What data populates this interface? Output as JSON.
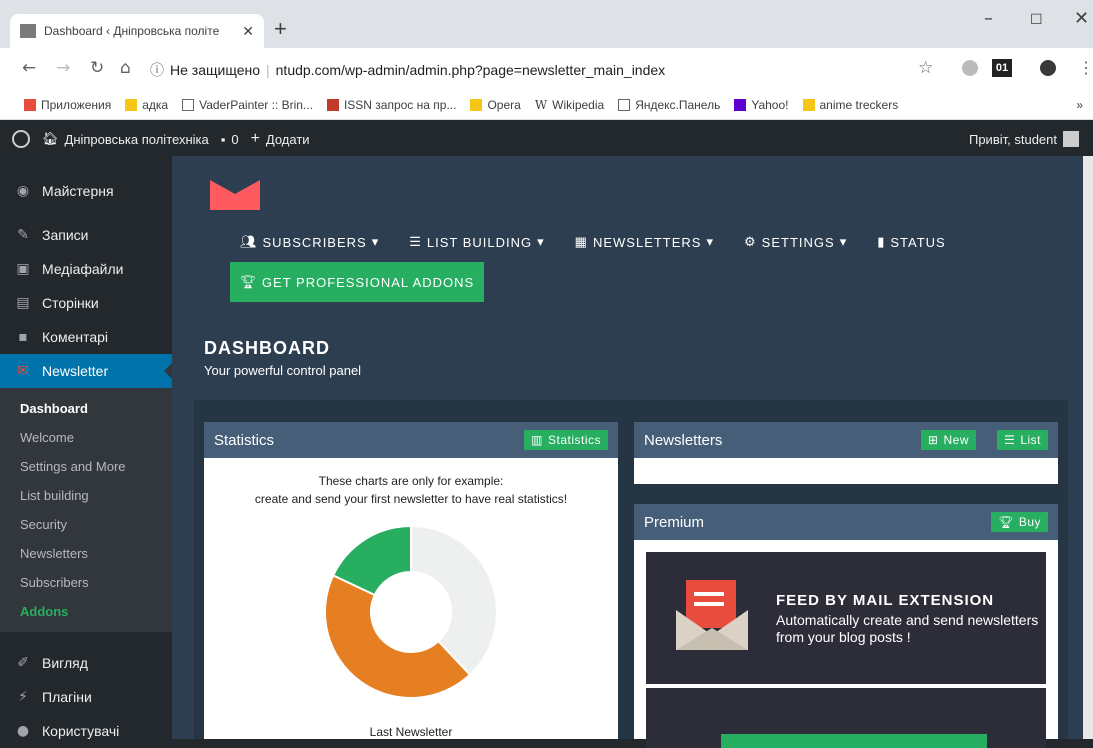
{
  "browser": {
    "tab_title": "Dashboard ‹ Дніпровська політе",
    "address_security": "Не защищено",
    "address_url": "ntudp.com/wp-admin/admin.php?page=newsletter_main_index",
    "bookmarks": [
      "Приложения",
      "адка",
      "VaderPainter :: Brin...",
      "ISSN запрос на пр...",
      "Opera",
      "Wikipedia",
      "Яндекс.Панель",
      "Yahoo!",
      "anime treckers"
    ],
    "ext_label": "01",
    "more_bookmarks": "»"
  },
  "adminbar": {
    "site_name": "Дніпровська політехніка",
    "comments_count": "0",
    "add_label": "Додати",
    "greeting": "Привіт, student"
  },
  "sidebar": {
    "items_top": [
      "Майстерня",
      "Записи",
      "Медіафайли",
      "Сторінки",
      "Коментарі"
    ],
    "newsletter_label": "Newsletter",
    "submenu": [
      "Dashboard",
      "Welcome",
      "Settings and More",
      "List building",
      "Security",
      "Newsletters",
      "Subscribers",
      "Addons"
    ],
    "items_bottom": [
      "Вигляд",
      "Плагіни",
      "Користувачі"
    ]
  },
  "plugin_nav": {
    "subscribers": "SUBSCRIBERS",
    "list_building": "LIST BUILDING",
    "newsletters": "NEWSLETTERS",
    "settings": "SETTINGS",
    "status": "STATUS",
    "pro_addons": "GET PROFESSIONAL ADDONS"
  },
  "dashboard": {
    "title": "DASHBOARD",
    "subtitle": "Your powerful control panel"
  },
  "statistics_panel": {
    "title": "Statistics",
    "button": "Statistics",
    "note_line1": "These charts are only for example:",
    "note_line2": "create and send your first newsletter to have real statistics!",
    "chart_caption": "Last Newsletter"
  },
  "newsletters_panel": {
    "title": "Newsletters",
    "new_button": "New",
    "list_button": "List"
  },
  "premium_panel": {
    "title": "Premium",
    "buy_button": "Buy",
    "feed_title": "FEED BY MAIL EXTENSION",
    "feed_desc": "Automatically create and send newsletters from your blog posts !"
  },
  "chart_data": {
    "type": "pie",
    "values": [
      38,
      44,
      18
    ],
    "colors": [
      "#eef0f0",
      "#e67e22",
      "#27ae60"
    ]
  },
  "colors": {
    "accent_green": "#27ae60",
    "wp_blue": "#0073aa",
    "panel_header": "#465e78"
  }
}
